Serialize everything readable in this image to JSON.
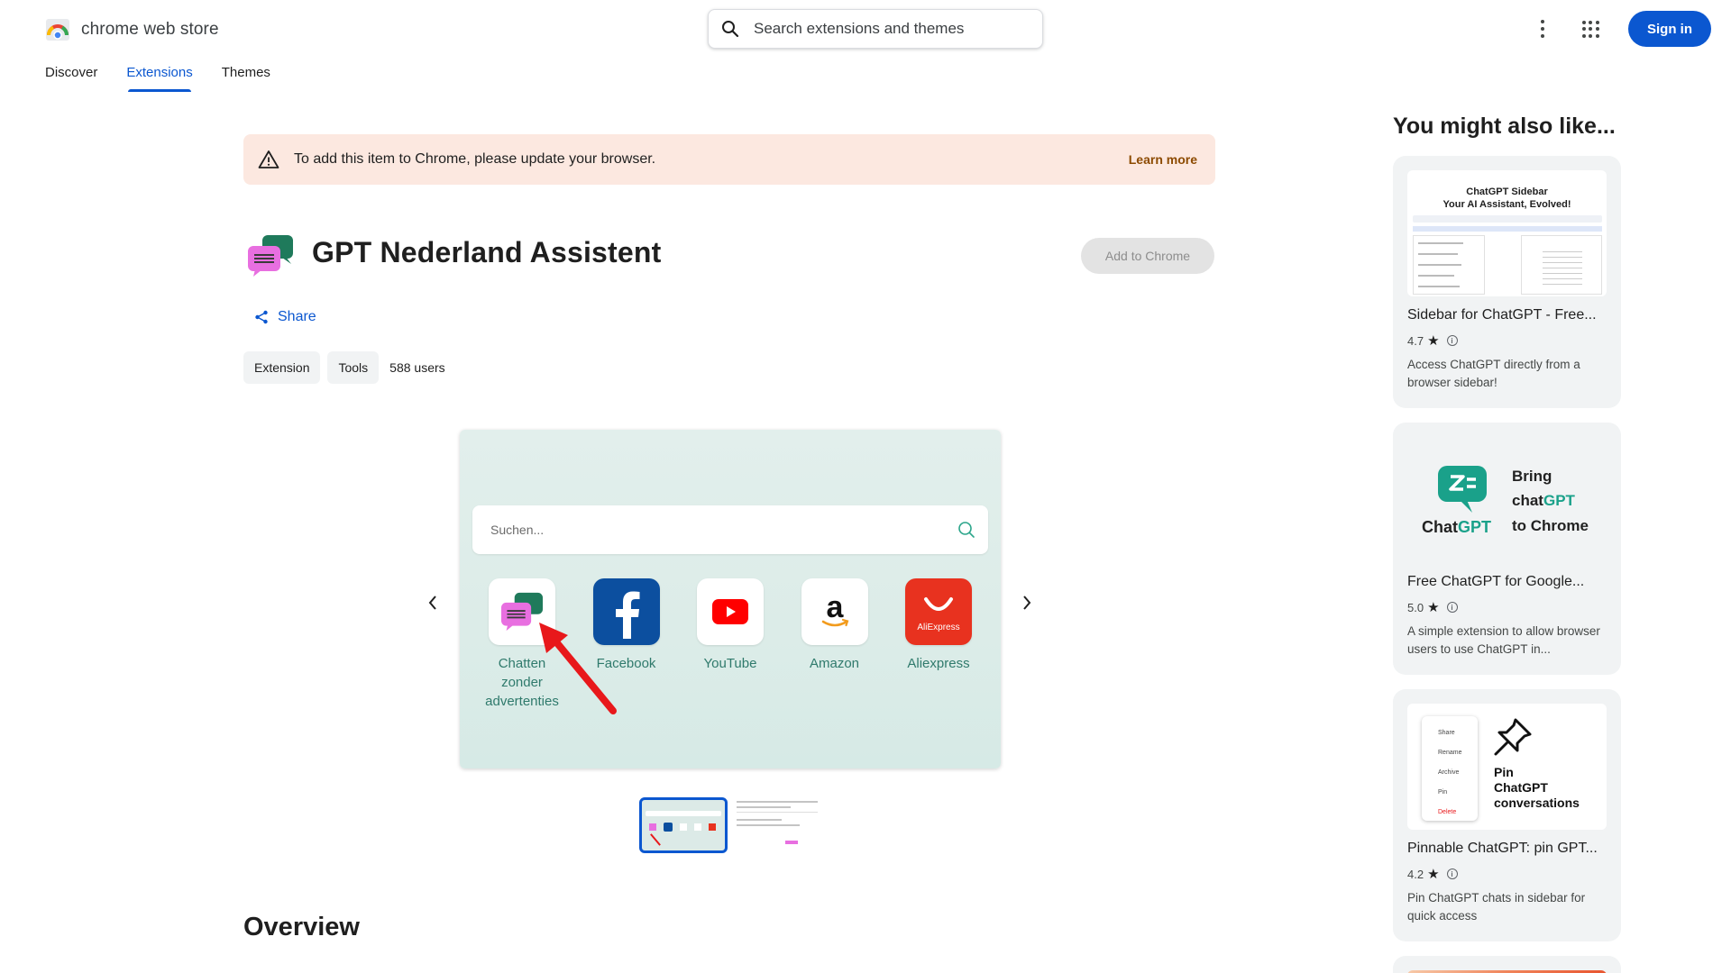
{
  "header": {
    "logo_text": "chrome web store",
    "search_placeholder": "Search extensions and themes",
    "sign_in": "Sign in"
  },
  "nav": [
    "Discover",
    "Extensions",
    "Themes"
  ],
  "banner": {
    "message": "To add this item to Chrome, please update your browser.",
    "link": "Learn more"
  },
  "extension": {
    "title": "GPT Nederland Assistent",
    "add_button": "Add to Chrome",
    "share": "Share",
    "chips": [
      "Extension",
      "Tools"
    ],
    "users": "588 users"
  },
  "screenshot": {
    "search_placeholder": "Suchen...",
    "tiles": [
      {
        "label": "Chatten zonder advertenties",
        "icon": "chat-bubbles-icon"
      },
      {
        "label": "Facebook",
        "icon": "facebook-icon"
      },
      {
        "label": "YouTube",
        "icon": "youtube-icon"
      },
      {
        "label": "Amazon",
        "icon": "amazon-icon"
      },
      {
        "label": "Aliexpress",
        "icon": "aliexpress-icon"
      }
    ],
    "aliexpress_logo_text": "AliExpress"
  },
  "overview_heading": "Overview",
  "sidebar": {
    "title": "You might also like...",
    "cards": [
      {
        "name": "Sidebar for ChatGPT - Free...",
        "rating": "4.7",
        "description": "Access ChatGPT directly from a browser sidebar!",
        "promo_title": "ChatGPT Sidebar",
        "promo_subtitle": "Your AI Assistant, Evolved!"
      },
      {
        "name": "Free ChatGPT for Google...",
        "rating": "5.0",
        "description": "A simple extension to allow browser users to use ChatGPT in...",
        "promo_line1": "Bring",
        "promo_line2_a": "chat",
        "promo_line2_b": "GPT",
        "promo_line3": "to Chrome",
        "promo_logo_a": "Chat",
        "promo_logo_b": "GPT"
      },
      {
        "name": "Pinnable ChatGPT: pin GPT...",
        "rating": "4.2",
        "description": "Pin ChatGPT chats in sidebar for quick access",
        "promo_menu": [
          "Share",
          "Rename",
          "Archive",
          "Pin",
          "Delete"
        ],
        "promo_text": [
          "Pin",
          "ChatGPT",
          "conversations"
        ]
      }
    ]
  },
  "colors": {
    "accent": "#0b57d0",
    "banner_bg": "#fce8e0",
    "banner_link": "#8c4a00",
    "tile_label": "#2f7a6c"
  }
}
